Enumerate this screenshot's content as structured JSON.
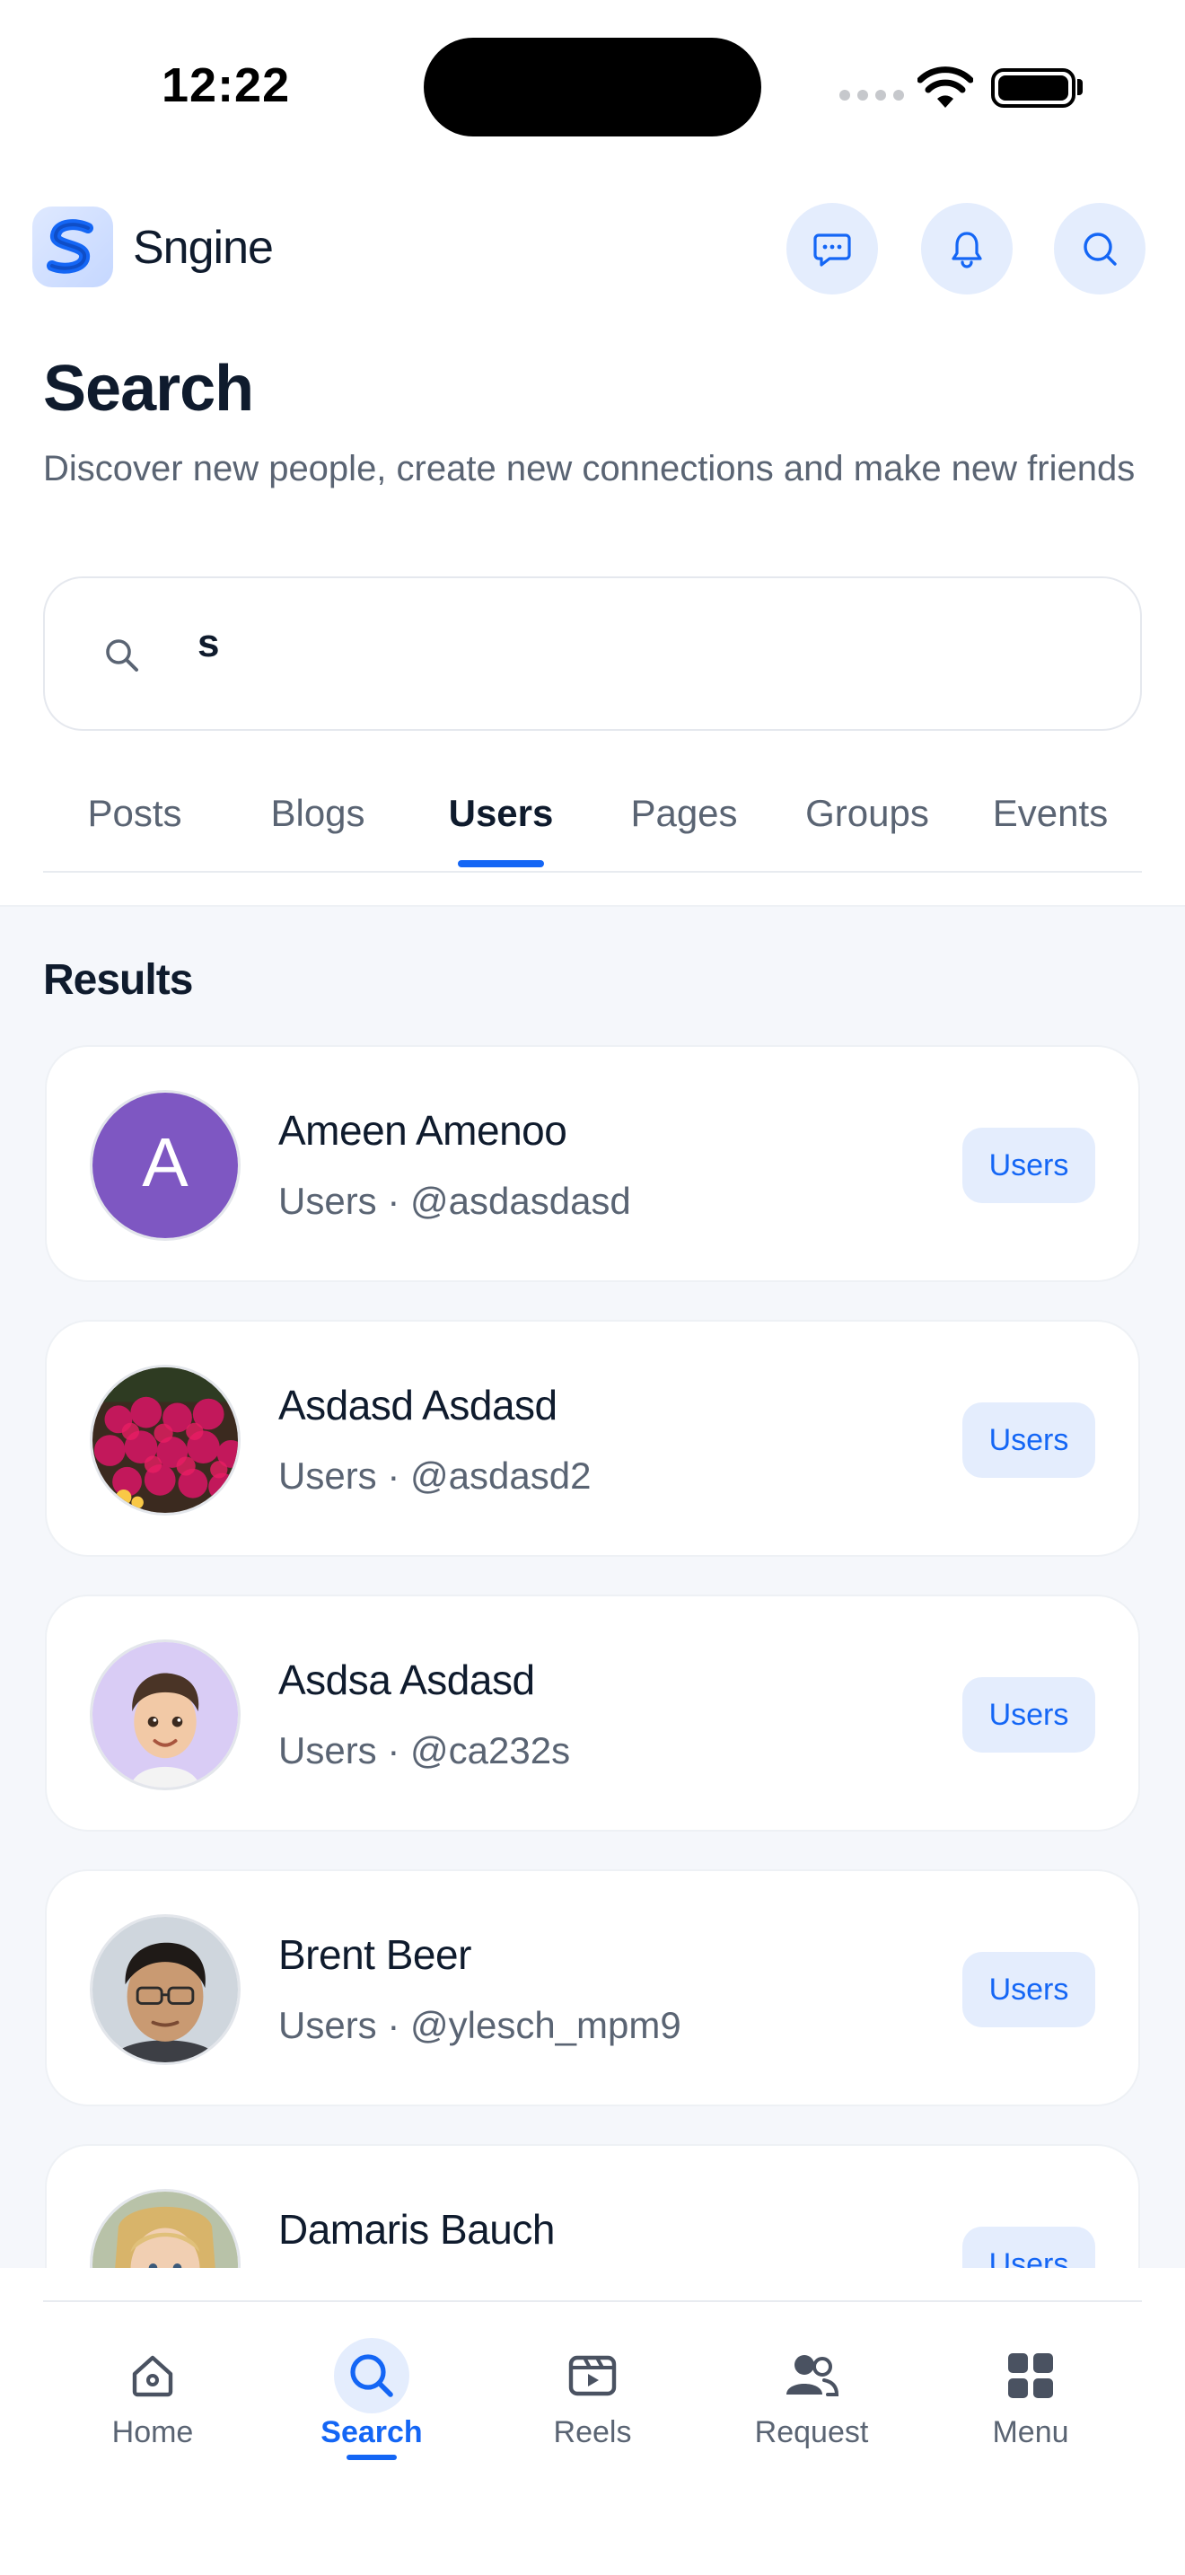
{
  "status_bar": {
    "time": "12:22"
  },
  "header": {
    "app_name": "Sngine"
  },
  "page": {
    "title": "Search",
    "subtitle": "Discover new people, create new connections and make new friends"
  },
  "search": {
    "value": "s"
  },
  "tabs": [
    {
      "label": "Posts"
    },
    {
      "label": "Blogs"
    },
    {
      "label": "Users"
    },
    {
      "label": "Pages"
    },
    {
      "label": "Groups"
    },
    {
      "label": "Events"
    }
  ],
  "active_tab": "Users",
  "results": {
    "heading": "Results",
    "items": [
      {
        "name": "Ameen Amenoo",
        "meta": "Users · @asdasdasd",
        "badge": "Users",
        "avatar_initial": "A"
      },
      {
        "name": "Asdasd Asdasd",
        "meta": "Users · @asdasd2",
        "badge": "Users"
      },
      {
        "name": "Asdsa Asdasd",
        "meta": "Users · @ca232s",
        "badge": "Users"
      },
      {
        "name": "Brent Beer",
        "meta": "Users · @ylesch_mpm9",
        "badge": "Users"
      },
      {
        "name": "Damaris Bauch",
        "badge": "Users"
      }
    ]
  },
  "bottom_nav": [
    {
      "label": "Home",
      "icon": "home-icon"
    },
    {
      "label": "Search",
      "icon": "search-icon"
    },
    {
      "label": "Reels",
      "icon": "reels-icon"
    },
    {
      "label": "Request",
      "icon": "users-icon"
    },
    {
      "label": "Menu",
      "icon": "grid-icon"
    }
  ],
  "colors": {
    "accent": "#1466f5",
    "accent_soft": "#e4edfd",
    "text": "#0f1b2d",
    "muted": "#5a6473",
    "avatar_purple": "#7e57c2"
  }
}
